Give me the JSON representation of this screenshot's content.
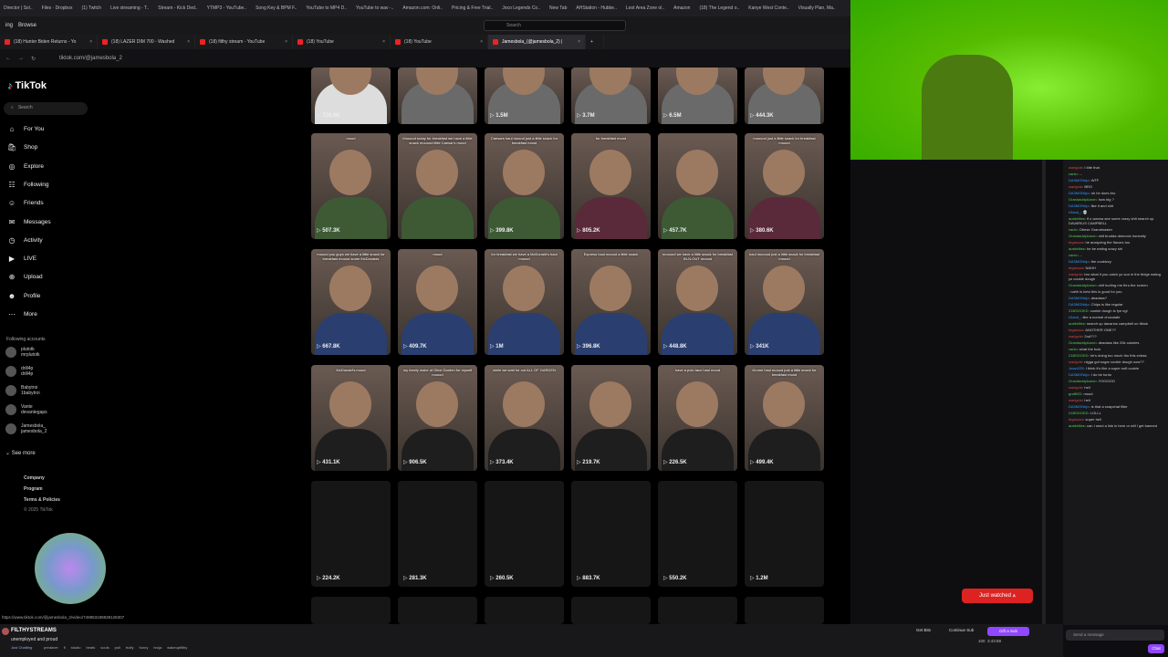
{
  "bookmarks": [
    "Director | Sol..",
    "Files · Dropbox",
    "(1) Twitch",
    "Live streaming - T..",
    "Stream - Kick Ded..",
    "YTMP3 - YouTube..",
    "Song Key & BPM F..",
    "YouTube to MP4 D..",
    "YouTube to wav -..",
    "Amazon.com: Onli..",
    "Pricing & Free Trial..",
    "Joco Legends Co..",
    "New Tab",
    "AHStation - Hubbe..",
    "Loot Area Zone ol..",
    "Amazon",
    "(18) The Legend o..",
    "Kanye West Conte..",
    "Visually Plan, Ma.."
  ],
  "menu": {
    "items": [
      "ing",
      "Browse"
    ],
    "search_placeholder": "Search"
  },
  "tabs": [
    {
      "label": "(18) Hunter Biden Returns - Yo"
    },
    {
      "label": "(18) LAZER DIM 700 - Washed"
    },
    {
      "label": "(18) filthy stream - YouTube"
    },
    {
      "label": "(18) YouTube"
    },
    {
      "label": "(18) YouTube"
    },
    {
      "label": "Jamesbola_(@jamesbola_2) | "
    }
  ],
  "url": "tiktok.com/@jamesbola_2",
  "tiktok": {
    "logo": "TikTok",
    "search_placeholder": "Search",
    "nav": [
      "For You",
      "Shop",
      "Explore",
      "Following",
      "Friends",
      "Messages",
      "Activity",
      "LIVE",
      "Upload",
      "Profile",
      "More"
    ],
    "following_header": "Following accounts",
    "accounts": [
      {
        "name": "plutotk",
        "handle": "mrplutotk"
      },
      {
        "name": "drill4p",
        "handle": "drill4p"
      },
      {
        "name": "Babytroi",
        "handle": "1babytroi"
      },
      {
        "name": "Vante",
        "handle": "devantegaps"
      },
      {
        "name": "Jamesbola_",
        "handle": "jamesbola_2"
      }
    ],
    "see_more": "See more",
    "footer": [
      "Company",
      "Program",
      "Terms & Policies",
      "© 2025 TikTok"
    ],
    "status_url": "https://www.tiktok.com/@jamesbola_2/video/749853188838128307",
    "rows": [
      [
        {
          "cap": "",
          "v": "726.6K"
        },
        {
          "cap": "",
          "v": ""
        },
        {
          "cap": "",
          "v": "1.5M"
        },
        {
          "cap": "",
          "v": "3.7M"
        },
        {
          "cap": "",
          "v": "6.5M"
        },
        {
          "cap": "",
          "v": "444.3K"
        }
      ],
      [
        {
          "cap": "mood",
          "v": "507.3K"
        },
        {
          "cap": "Mooood today for breakfast we have a little snack mooood little Caesar's mood",
          "v": ""
        },
        {
          "cap": "Caesars haul moood just a little snack for breakfast mood",
          "v": "399.8K"
        },
        {
          "cap": "for breakfast mood",
          "v": "805.2K"
        },
        {
          "cap": "",
          "v": "457.7K"
        },
        {
          "cap": "mooood just a little snack for breakfast moood",
          "v": "380.6K"
        }
      ],
      [
        {
          "cap": "moood you guys we have a little snack for breakfast moood some McDonalds",
          "v": "667.8K"
        },
        {
          "cap": "mood",
          "v": "409.7K"
        },
        {
          "cap": "for breakfast we have a McDonald's haul moood",
          "v": "1M"
        },
        {
          "cap": "Express haul moood a little snack",
          "v": "396.8K"
        },
        {
          "cap": "mooood we have a little snack for breakfast IN-N-OUT moood",
          "v": "448.8K"
        },
        {
          "cap": "haul mooood just a little snack for breakfast moood",
          "v": "341K"
        }
      ],
      [
        {
          "cap": "McDonald's mood",
          "v": "431.1K"
        },
        {
          "cap": "my family make of Olive Garden for myself moood",
          "v": "906.5K"
        },
        {
          "cap": "while we wait for out ALL OF GARDEN",
          "v": "373.4K"
        },
        {
          "cap": "",
          "v": "219.7K"
        },
        {
          "cap": "have a polo taco haul mood",
          "v": "226.5K"
        },
        {
          "cap": "Krome haul moood just a little snack for breakfast mood",
          "v": "499.4K"
        }
      ],
      [
        {
          "cap": "",
          "v": "224.2K"
        },
        {
          "cap": "",
          "v": "281.3K"
        },
        {
          "cap": "",
          "v": "260.5K"
        },
        {
          "cap": "",
          "v": "883.7K"
        },
        {
          "cap": "",
          "v": "550.2K"
        },
        {
          "cap": "",
          "v": "1.2M"
        }
      ]
    ]
  },
  "chat": {
    "messages": [
      {
        "u": "warlgoIe",
        "c": "#d44",
        "t": "I bite that"
      },
      {
        "u": "vanlo",
        "c": "#5c5",
        "t": "..."
      },
      {
        "u": "DA3MONirjo",
        "c": "#39f",
        "t": "WTF"
      },
      {
        "u": "warlgoIe",
        "c": "#d44",
        "t": "BRO"
      },
      {
        "u": "DA3MONirjo",
        "c": "#39f",
        "t": "oh he does bro"
      },
      {
        "u": "GrandaddyAaron",
        "c": "#5c5",
        "t": "how big ?"
      },
      {
        "u": "DA3MONirjo",
        "c": "#39f",
        "t": "like it and shit"
      },
      {
        "u": "r0land_",
        "c": "#39f",
        "t": "💀"
      },
      {
        "u": "austielites",
        "c": "#5c5",
        "t": "if u wanna see some crazy shit search up DAVARIUS CAMPBELL"
      },
      {
        "u": "vanlo",
        "c": "#5c5",
        "t": "Obese Grandmaster"
      },
      {
        "u": "GrandaddyAaron",
        "c": "#5c5",
        "t": "shit brudda demonic honestly"
      },
      {
        "u": "tegasous",
        "c": "#d44",
        "t": "he analyzing the flavors too"
      },
      {
        "u": "austielites",
        "c": "#5c5",
        "t": "he be eating crazy shi"
      },
      {
        "u": "vanlo",
        "c": "#5c5",
        "t": "..."
      },
      {
        "u": "DA3MONirjo",
        "c": "#39f",
        "t": "the cooktzzy"
      },
      {
        "u": "tegasous",
        "c": "#d44",
        "t": "NAHH"
      },
      {
        "u": "warlgoIe",
        "c": "#d44",
        "t": "bro what if you catch yo son in the fridge eating yo cookie dough"
      },
      {
        "u": "GrandaddyAaron",
        "c": "#5c5",
        "t": "shit hurting me thru the screen"
      },
      {
        "u": "",
        "c": "#d44",
        "t": "nahh is keto this is good for you"
      },
      {
        "u": "DA3MONirjo",
        "c": "#39f",
        "t": "deadass?"
      },
      {
        "u": "DA3MONirjo",
        "c": "#39f",
        "t": "Chips is like regular"
      },
      {
        "u": "21BSGOKD",
        "c": "#5c5",
        "t": "cookie dough is fye ngl"
      },
      {
        "u": "r0land_",
        "c": "#39f",
        "t": "like a normal chocolate"
      },
      {
        "u": "austielites",
        "c": "#5c5",
        "t": "search up davarius campbell on tiktok"
      },
      {
        "u": "tegasous",
        "c": "#d44",
        "t": "ANOTHER ONE??"
      },
      {
        "u": "warlgoIe",
        "c": "#d44",
        "t": "2nd???"
      },
      {
        "u": "GrandaddyAaron",
        "c": "#5c5",
        "t": "deadass like 20k calories"
      },
      {
        "u": "vanlo",
        "c": "#5c5",
        "t": "what the fuck"
      },
      {
        "u": "21BSGOKD",
        "c": "#5c5",
        "t": "he's doing too much tho this extras"
      },
      {
        "u": "warlgoIe",
        "c": "#d44",
        "t": "nigga got sugar cookie dough now??"
      },
      {
        "u": "Jman225",
        "c": "#39f",
        "t": "I think it's like a super soft cookie"
      },
      {
        "u": "DA3MONirjo",
        "c": "#39f",
        "t": "I do be tonto"
      },
      {
        "u": "GrandaddyAaron",
        "c": "#5c5",
        "t": "YOOOOO"
      },
      {
        "u": "warlgoIe",
        "c": "#d44",
        "t": "hell"
      },
      {
        "u": "grailKID",
        "c": "#5c5",
        "t": "mood"
      },
      {
        "u": "warlgoIe",
        "c": "#d44",
        "t": "hell"
      },
      {
        "u": "DA3MONirjo",
        "c": "#39f",
        "t": "is that a snapchat filter"
      },
      {
        "u": "21BSGOKD",
        "c": "#5c5",
        "t": "LOLLL"
      },
      {
        "u": "tegasous",
        "c": "#d44",
        "t": "super hell"
      },
      {
        "u": "austielites",
        "c": "#5c5",
        "t": "can I send a link in here or will I get banned"
      }
    ],
    "just_watched": "Just watched",
    "input_placeholder": "Send a message",
    "chat_button": "Chat"
  },
  "stream": {
    "name": "FILTHYSTREAMS",
    "title": "unemployed and proud",
    "category": "Just Chatting",
    "tags": [
      "predaver",
      "fl",
      "studio",
      "beats",
      "souls",
      "poli",
      "trulfy",
      "funny",
      "bruja",
      "wakeupfilthy"
    ],
    "get_bits": "Get Bits",
    "continue_sub": "Continue Sub",
    "gift_sub": "Gift a Sub",
    "viewers": "100",
    "uptime": "3:43:58"
  },
  "colors": {
    "twitch_purple": "#9147ff",
    "tiktok_bg": "#000000",
    "red": "#dd2222"
  }
}
